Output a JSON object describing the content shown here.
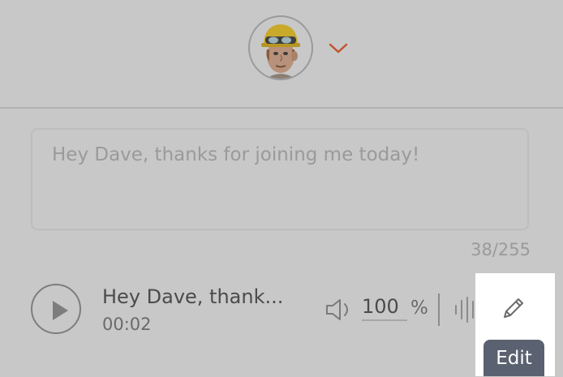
{
  "header": {
    "avatar_icon": "construction-worker-avatar",
    "dropdown_icon": "chevron-down-icon",
    "accent": "#c0542c"
  },
  "editor": {
    "text": "Hey Dave, thanks for joining me today!",
    "counter": "38/255"
  },
  "player": {
    "play_icon": "play-icon",
    "title": "Hey Dave, thank...",
    "time": "00:02",
    "volume_icon": "speaker-icon",
    "volume_value": "100",
    "volume_unit": "%",
    "waveform_icon": "waveform-icon",
    "edit_icon": "pencil-icon",
    "edit_tooltip": "Edit"
  }
}
